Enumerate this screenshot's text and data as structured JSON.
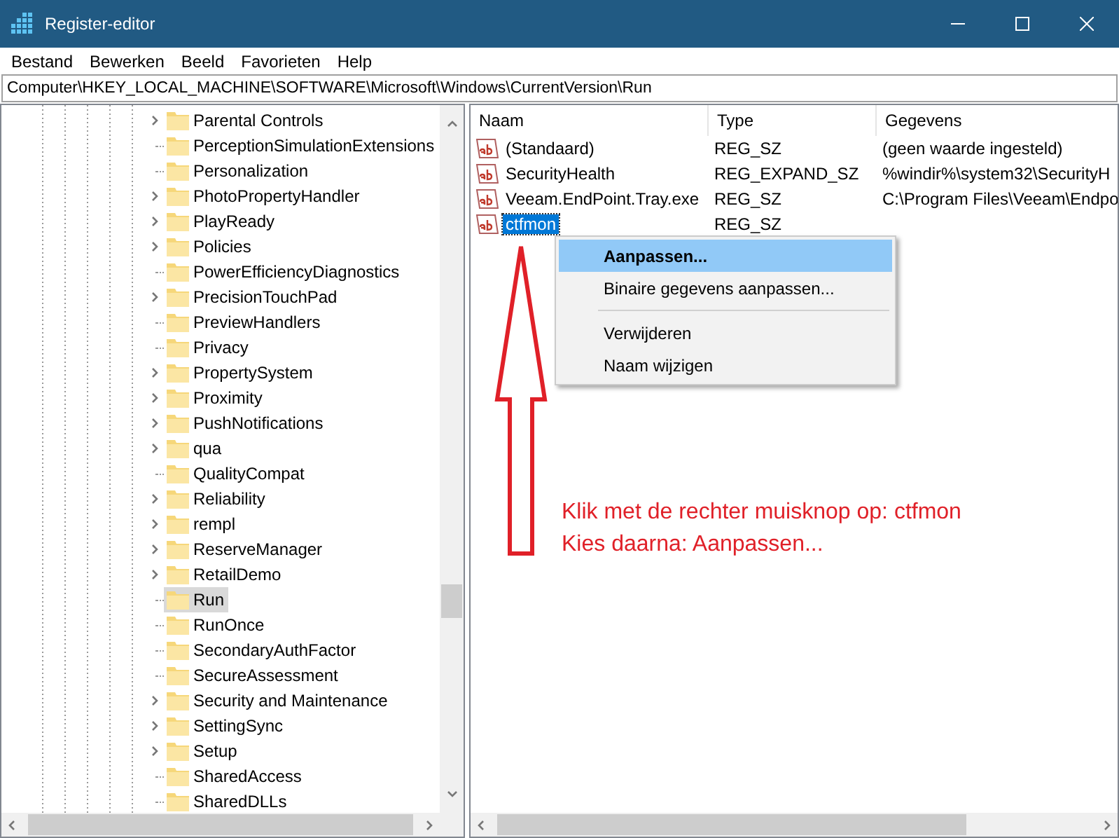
{
  "window": {
    "title": "Register-editor"
  },
  "menu": [
    "Bestand",
    "Bewerken",
    "Beeld",
    "Favorieten",
    "Help"
  ],
  "address": "Computer\\HKEY_LOCAL_MACHINE\\SOFTWARE\\Microsoft\\Windows\\CurrentVersion\\Run",
  "tree": {
    "items": [
      {
        "label": "Parental Controls",
        "expandable": true,
        "selected": false
      },
      {
        "label": "PerceptionSimulationExtensions",
        "expandable": false,
        "selected": false
      },
      {
        "label": "Personalization",
        "expandable": false,
        "selected": false
      },
      {
        "label": "PhotoPropertyHandler",
        "expandable": true,
        "selected": false
      },
      {
        "label": "PlayReady",
        "expandable": true,
        "selected": false
      },
      {
        "label": "Policies",
        "expandable": true,
        "selected": false
      },
      {
        "label": "PowerEfficiencyDiagnostics",
        "expandable": false,
        "selected": false
      },
      {
        "label": "PrecisionTouchPad",
        "expandable": true,
        "selected": false
      },
      {
        "label": "PreviewHandlers",
        "expandable": false,
        "selected": false
      },
      {
        "label": "Privacy",
        "expandable": false,
        "selected": false
      },
      {
        "label": "PropertySystem",
        "expandable": true,
        "selected": false
      },
      {
        "label": "Proximity",
        "expandable": true,
        "selected": false
      },
      {
        "label": "PushNotifications",
        "expandable": true,
        "selected": false
      },
      {
        "label": "qua",
        "expandable": true,
        "selected": false
      },
      {
        "label": "QualityCompat",
        "expandable": false,
        "selected": false
      },
      {
        "label": "Reliability",
        "expandable": true,
        "selected": false
      },
      {
        "label": "rempl",
        "expandable": true,
        "selected": false
      },
      {
        "label": "ReserveManager",
        "expandable": true,
        "selected": false
      },
      {
        "label": "RetailDemo",
        "expandable": true,
        "selected": false
      },
      {
        "label": "Run",
        "expandable": false,
        "selected": true
      },
      {
        "label": "RunOnce",
        "expandable": false,
        "selected": false
      },
      {
        "label": "SecondaryAuthFactor",
        "expandable": false,
        "selected": false
      },
      {
        "label": "SecureAssessment",
        "expandable": false,
        "selected": false
      },
      {
        "label": "Security and Maintenance",
        "expandable": true,
        "selected": false
      },
      {
        "label": "SettingSync",
        "expandable": true,
        "selected": false
      },
      {
        "label": "Setup",
        "expandable": true,
        "selected": false
      },
      {
        "label": "SharedAccess",
        "expandable": false,
        "selected": false
      },
      {
        "label": "SharedDLLs",
        "expandable": false,
        "selected": false
      }
    ]
  },
  "values": {
    "columns": [
      "Naam",
      "Type",
      "Gegevens"
    ],
    "rows": [
      {
        "name": "(Standaard)",
        "type": "REG_SZ",
        "data": "(geen waarde ingesteld)",
        "selected": false
      },
      {
        "name": "SecurityHealth",
        "type": "REG_EXPAND_SZ",
        "data": "%windir%\\system32\\SecurityH",
        "selected": false
      },
      {
        "name": "Veeam.EndPoint.Tray.exe",
        "type": "REG_SZ",
        "data": "C:\\Program Files\\Veeam\\Endpo",
        "selected": false
      },
      {
        "name": "ctfmon",
        "type": "REG_SZ",
        "data": "",
        "selected": true
      }
    ]
  },
  "context_menu": {
    "items": [
      {
        "kind": "item",
        "label": "Aanpassen...",
        "selected": true,
        "default": true
      },
      {
        "kind": "item",
        "label": "Binaire gegevens aanpassen...",
        "selected": false,
        "default": false
      },
      {
        "kind": "separator"
      },
      {
        "kind": "item",
        "label": "Verwijderen",
        "selected": false,
        "default": false
      },
      {
        "kind": "item",
        "label": "Naam wijzigen",
        "selected": false,
        "default": false
      }
    ]
  },
  "annotation": {
    "lines": [
      "Klik met de rechter muisknop op: ctfmon",
      "Kies daarna: Aanpassen..."
    ]
  }
}
